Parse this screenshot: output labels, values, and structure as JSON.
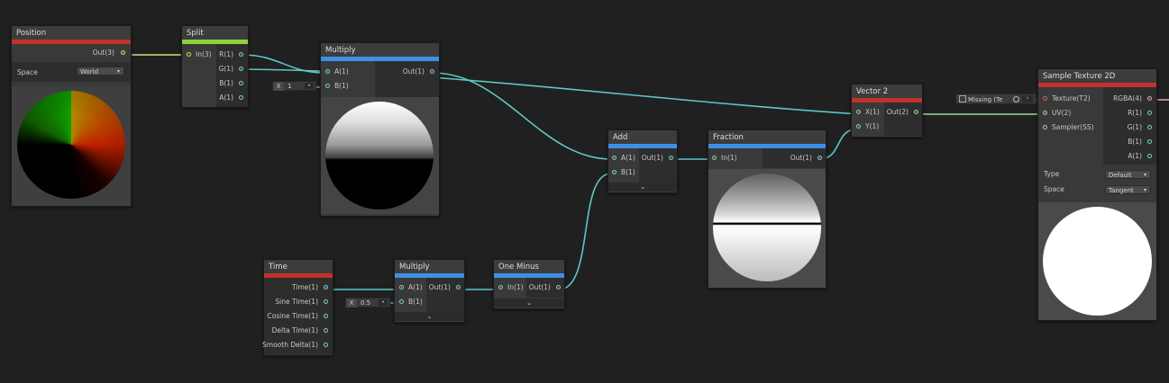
{
  "nodes": {
    "position": {
      "title": "Position",
      "out_label": "Out(3)",
      "space_label": "Space",
      "space_value": "World"
    },
    "split": {
      "title": "Split",
      "in_label": "In(3)",
      "outs": [
        "R(1)",
        "G(1)",
        "B(1)",
        "A(1)"
      ]
    },
    "multiply_top": {
      "title": "Multiply",
      "in_a": "A(1)",
      "in_b": "B(1)",
      "out_label": "Out(1)",
      "b_field_label": "X",
      "b_field_value": "1"
    },
    "add": {
      "title": "Add",
      "in_a": "A(1)",
      "in_b": "B(1)",
      "out_label": "Out(1)"
    },
    "fraction": {
      "title": "Fraction",
      "in_label": "In(1)",
      "out_label": "Out(1)"
    },
    "vector2": {
      "title": "Vector 2",
      "in_x": "X(1)",
      "in_y": "Y(1)",
      "out_label": "Out(2)"
    },
    "sample_texture": {
      "title": "Sample Texture 2D",
      "inputs": [
        "Texture(T2)",
        "UV(2)",
        "Sampler(SS)"
      ],
      "outputs": [
        "RGBA(4)",
        "R(1)",
        "G(1)",
        "B(1)",
        "A(1)"
      ],
      "missing_label": "Missing (Te",
      "type_label": "Type",
      "type_value": "Default",
      "space_label": "Space",
      "space_value": "Tangent"
    },
    "time": {
      "title": "Time",
      "outs": [
        "Time(1)",
        "Sine Time(1)",
        "Cosine Time(1)",
        "Delta Time(1)",
        "Smooth Delta(1)"
      ]
    },
    "multiply_bottom": {
      "title": "Multiply",
      "in_a": "A(1)",
      "in_b": "B(1)",
      "out_label": "Out(1)",
      "b_field_label": "X",
      "b_field_value": "0.5"
    },
    "one_minus": {
      "title": "One Minus",
      "in_label": "In(1)",
      "out_label": "Out(1)"
    }
  },
  "colors": {
    "background": "#202020",
    "wire_float": "#5ec6c4",
    "wire_vector3": "#d9d97a",
    "wire_vector2": "#9fd89a",
    "wire_vector4": "#e9a0c9",
    "header_red": "#c0322a",
    "header_blue": "#3d8fe8",
    "header_green": "#8fd13b"
  },
  "icons": {
    "dropdown_caret": "▾",
    "expander_chevron": "⌄",
    "mini_dot": "•"
  }
}
